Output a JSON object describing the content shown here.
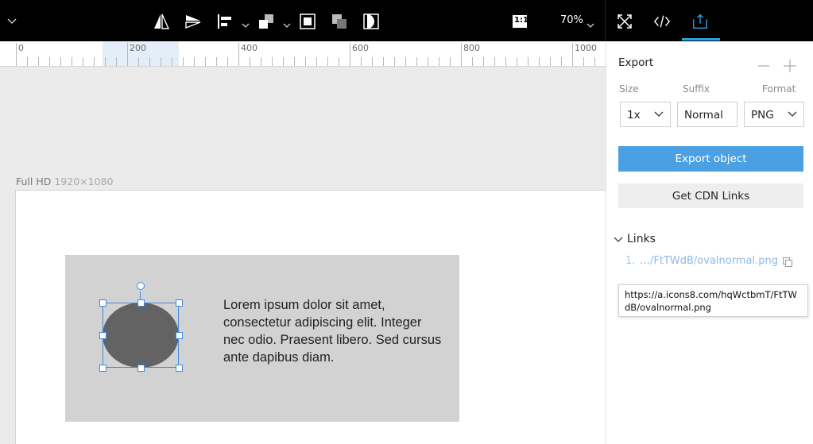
{
  "toolbar": {
    "zoom_level": "70%",
    "icons": [
      "chevron-down-icon",
      "flip-horizontal-icon",
      "flip-vertical-icon",
      "align-left-icon",
      "chevron-down-icon",
      "arrange-icon",
      "chevron-down-icon",
      "frame-icon",
      "mask-icon",
      "contrast-icon",
      "actual-size-icon",
      "fit-screen-icon",
      "code-icon",
      "export-icon"
    ],
    "actual_size_label": "1:1",
    "accent_color": "#27a2e6"
  },
  "ruler": {
    "labels": [
      "0",
      "200",
      "400",
      "600",
      "800",
      "1000"
    ]
  },
  "canvas": {
    "artboard_name": "Full HD",
    "artboard_size": "1920×1080",
    "text_block": "Lorem ipsum dolor sit amet, consectetur adipiscing elit. Integer nec odio. Praesent libero. Sed cursus ante dapibus diam.",
    "oval_color": "#636363",
    "group_color": "#d2d2d2",
    "selection_color": "#3f8ae0"
  },
  "export_panel": {
    "title": "Export",
    "size_label": "Size",
    "suffix_label": "Suffix",
    "format_label": "Format",
    "size_value": "1x",
    "suffix_value": "Normal",
    "format_value": "PNG",
    "export_button": "Export object",
    "export_button_color": "#4aa0e2",
    "cdn_button": "Get CDN Links",
    "links_label": "Links",
    "links": [
      {
        "index": "1.",
        "short": "…/FtTWdB/ovalnormal.png"
      }
    ],
    "tooltip": "https://a.icons8.com/hqWctbmT/FtTWdB/ovalnormal.png"
  }
}
